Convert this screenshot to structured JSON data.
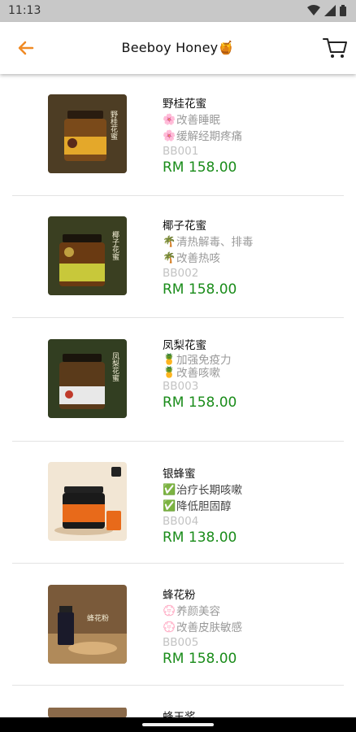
{
  "status_bar": {
    "time": "11:13"
  },
  "app_bar": {
    "title": "Beeboy Honey🍯",
    "accent_color": "#f08a24"
  },
  "products": [
    {
      "name": "野桂花蜜",
      "features": [
        [
          "🌸",
          "改善睡眠"
        ],
        [
          "🌸",
          "缓解经期疼痛"
        ]
      ],
      "code": "BB001",
      "price": "RM 158.00",
      "label": "野桂花蜜"
    },
    {
      "name": "椰子花蜜",
      "features": [
        [
          "🌴",
          "清热解毒、排毒"
        ],
        [
          "🌴",
          "改善热咳"
        ]
      ],
      "code": "BB002",
      "price": "RM 158.00",
      "label": "椰子花蜜"
    },
    {
      "name": "凤梨花蜜",
      "features": [
        [
          "🍍",
          "加强免疫力"
        ],
        [
          "🍍",
          "改善咳嗽"
        ]
      ],
      "code": "BB003",
      "price": "RM 158.00",
      "label": "凤梨花蜜"
    },
    {
      "name": "银蜂蜜",
      "features": [
        [
          "✅",
          "治疗长期咳嗽"
        ],
        [
          "✅",
          "降低胆固醇"
        ]
      ],
      "code": "BB004",
      "price": "RM 138.00",
      "label": "银蜂蜜"
    },
    {
      "name": "蜂花粉",
      "features": [
        [
          "💮",
          "养颜美容"
        ],
        [
          "💮",
          "改善皮肤敏感"
        ]
      ],
      "code": "BB005",
      "price": "RM 158.00",
      "label": "蜂花粉"
    },
    {
      "name": "蜂王浆",
      "features": [],
      "code": "",
      "price": "",
      "label": ""
    }
  ]
}
